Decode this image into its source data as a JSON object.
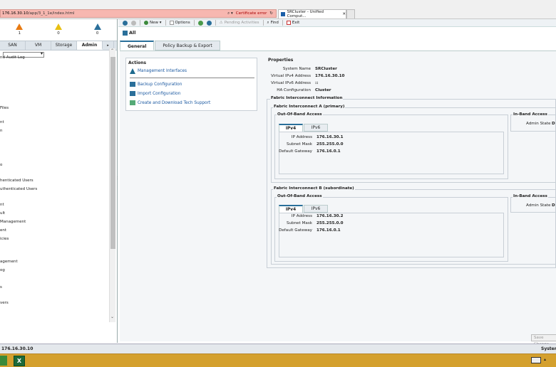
{
  "browser": {
    "url_host": "176.16.30.10",
    "url_path": "/app/3_1_1e/index.html",
    "cert_error": "Certificate error",
    "tab_title": "SRCluster - Unified Comput..."
  },
  "faults": [
    {
      "count": "1"
    },
    {
      "count": "0"
    },
    {
      "count": "0"
    }
  ],
  "nav_tabs": [
    "SAN",
    "VM",
    "Storage",
    "Admin",
    "▸"
  ],
  "tree_items": [
    "nd Audit Log",
    "Files",
    "nt",
    "n",
    "o",
    "henticated Users",
    "uthenticated Users",
    "nt",
    "ult",
    "Management",
    "ent",
    "icies",
    "agement",
    "og",
    "s",
    "vers"
  ],
  "toolbar": {
    "new_label": "New ▾",
    "options_label": "Options",
    "pending_label": "Pending Activities",
    "find_label": "Find",
    "exit_label": "Exit"
  },
  "breadcrumb": "All",
  "content_tabs": [
    "General",
    "Policy Backup & Export"
  ],
  "actions": {
    "title": "Actions",
    "items": [
      "Management Interfaces",
      "Backup Configuration",
      "Import Configuration",
      "Create and Download Tech Support"
    ]
  },
  "properties": {
    "title": "Properties",
    "rows": [
      {
        "k": "System Name",
        "v": "SRCluster"
      },
      {
        "k": "Virtual IPv4 Address",
        "v": "176.16.30.10"
      },
      {
        "k": "Virtual IPv6 Address",
        "v": "::"
      },
      {
        "k": "HA Configuration",
        "v": "Cluster"
      }
    ]
  },
  "fi_info_title": "Fabric Interconnect Information",
  "fi_a": {
    "title": "Fabric Interconnect A (primary)",
    "oob_title": "Out-Of-Band Access",
    "inband_title": "In-Band Access",
    "admin_state_label": "Admin State",
    "admin_state_value": "D",
    "tabs": [
      "IPv4",
      "IPv6"
    ],
    "rows": [
      {
        "k": "IP Address",
        "v": "176.16.30.1"
      },
      {
        "k": "Subnet Mask",
        "v": "255.255.0.0"
      },
      {
        "k": "Default Gateway",
        "v": "176.16.0.1"
      }
    ]
  },
  "fi_b": {
    "title": "Fabric Interconnect B (subordinate)",
    "oob_title": "Out-Of-Band Access",
    "inband_title": "In-Band Access",
    "admin_state_label": "Admin State",
    "admin_state_value": "D",
    "tabs": [
      "IPv4",
      "IPv6"
    ],
    "rows": [
      {
        "k": "IP Address",
        "v": "176.16.30.2"
      },
      {
        "k": "Subnet Mask",
        "v": "255.255.0.0"
      },
      {
        "k": "Default Gateway",
        "v": "176.16.0.1"
      }
    ]
  },
  "save_label": "Save Change",
  "status": {
    "ip": "176.16.30.10",
    "system": "System"
  },
  "taskbar": {
    "app2_letter": "X"
  }
}
